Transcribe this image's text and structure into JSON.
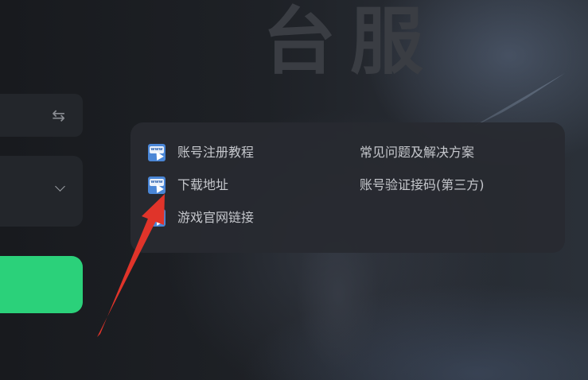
{
  "background": {
    "title_text": "台服"
  },
  "left_panel": {
    "swap_icon": "swap-arrows-icon",
    "dropdown_icon": "chevron-down-icon",
    "start_button_color": "#2bd17a"
  },
  "links_panel": {
    "left_column": [
      {
        "label": "账号注册教程",
        "icon": "www-link-icon"
      },
      {
        "label": "下载地址",
        "icon": "www-link-icon"
      },
      {
        "label": "游戏官网链接",
        "icon": "www-link-icon"
      }
    ],
    "right_column": [
      {
        "label": "常见问题及解决方案"
      },
      {
        "label": "账号验证接码(第三方)"
      }
    ]
  },
  "annotation": {
    "arrow_color": "#e0342a",
    "points_to": "下载地址"
  }
}
